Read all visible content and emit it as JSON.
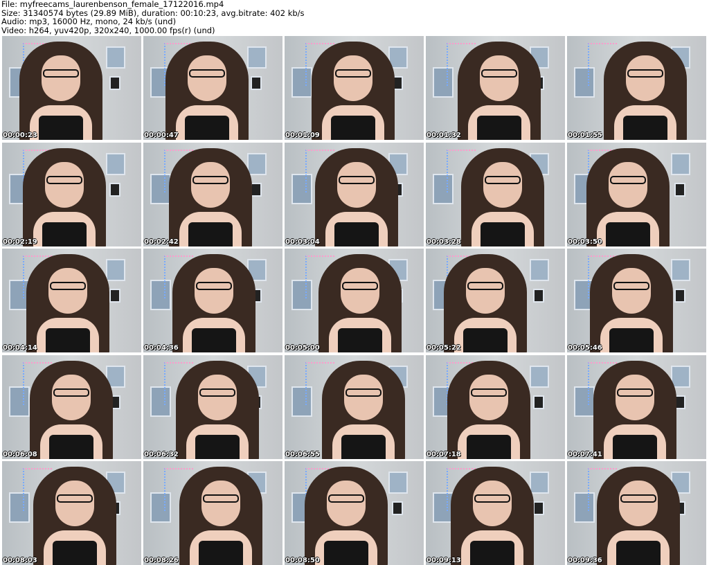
{
  "header": {
    "file": "File: myfreecams_laurenbenson_female_17122016.mp4",
    "size": "Size: 31340574 bytes (29.89 MiB), duration: 00:10:23, avg.bitrate: 402 kb/s",
    "audio": "Audio: mp3, 16000 Hz, mono, 24 kb/s (und)",
    "video": "Video: h264, yuv420p, 320x240, 1000.00 fps(r) (und)"
  },
  "thumbnails": [
    "00:00:23",
    "00:00:47",
    "00:01:09",
    "00:01:32",
    "00:01:55",
    "00:02:19",
    "00:02:42",
    "00:03:04",
    "00:03:28",
    "00:03:50",
    "00:04:14",
    "00:04:36",
    "00:05:00",
    "00:05:22",
    "00:05:46",
    "00:06:08",
    "00:06:32",
    "00:06:55",
    "00:07:18",
    "00:07:41",
    "00:08:03",
    "00:08:26",
    "00:08:50",
    "00:09:13",
    "00:09:36"
  ]
}
